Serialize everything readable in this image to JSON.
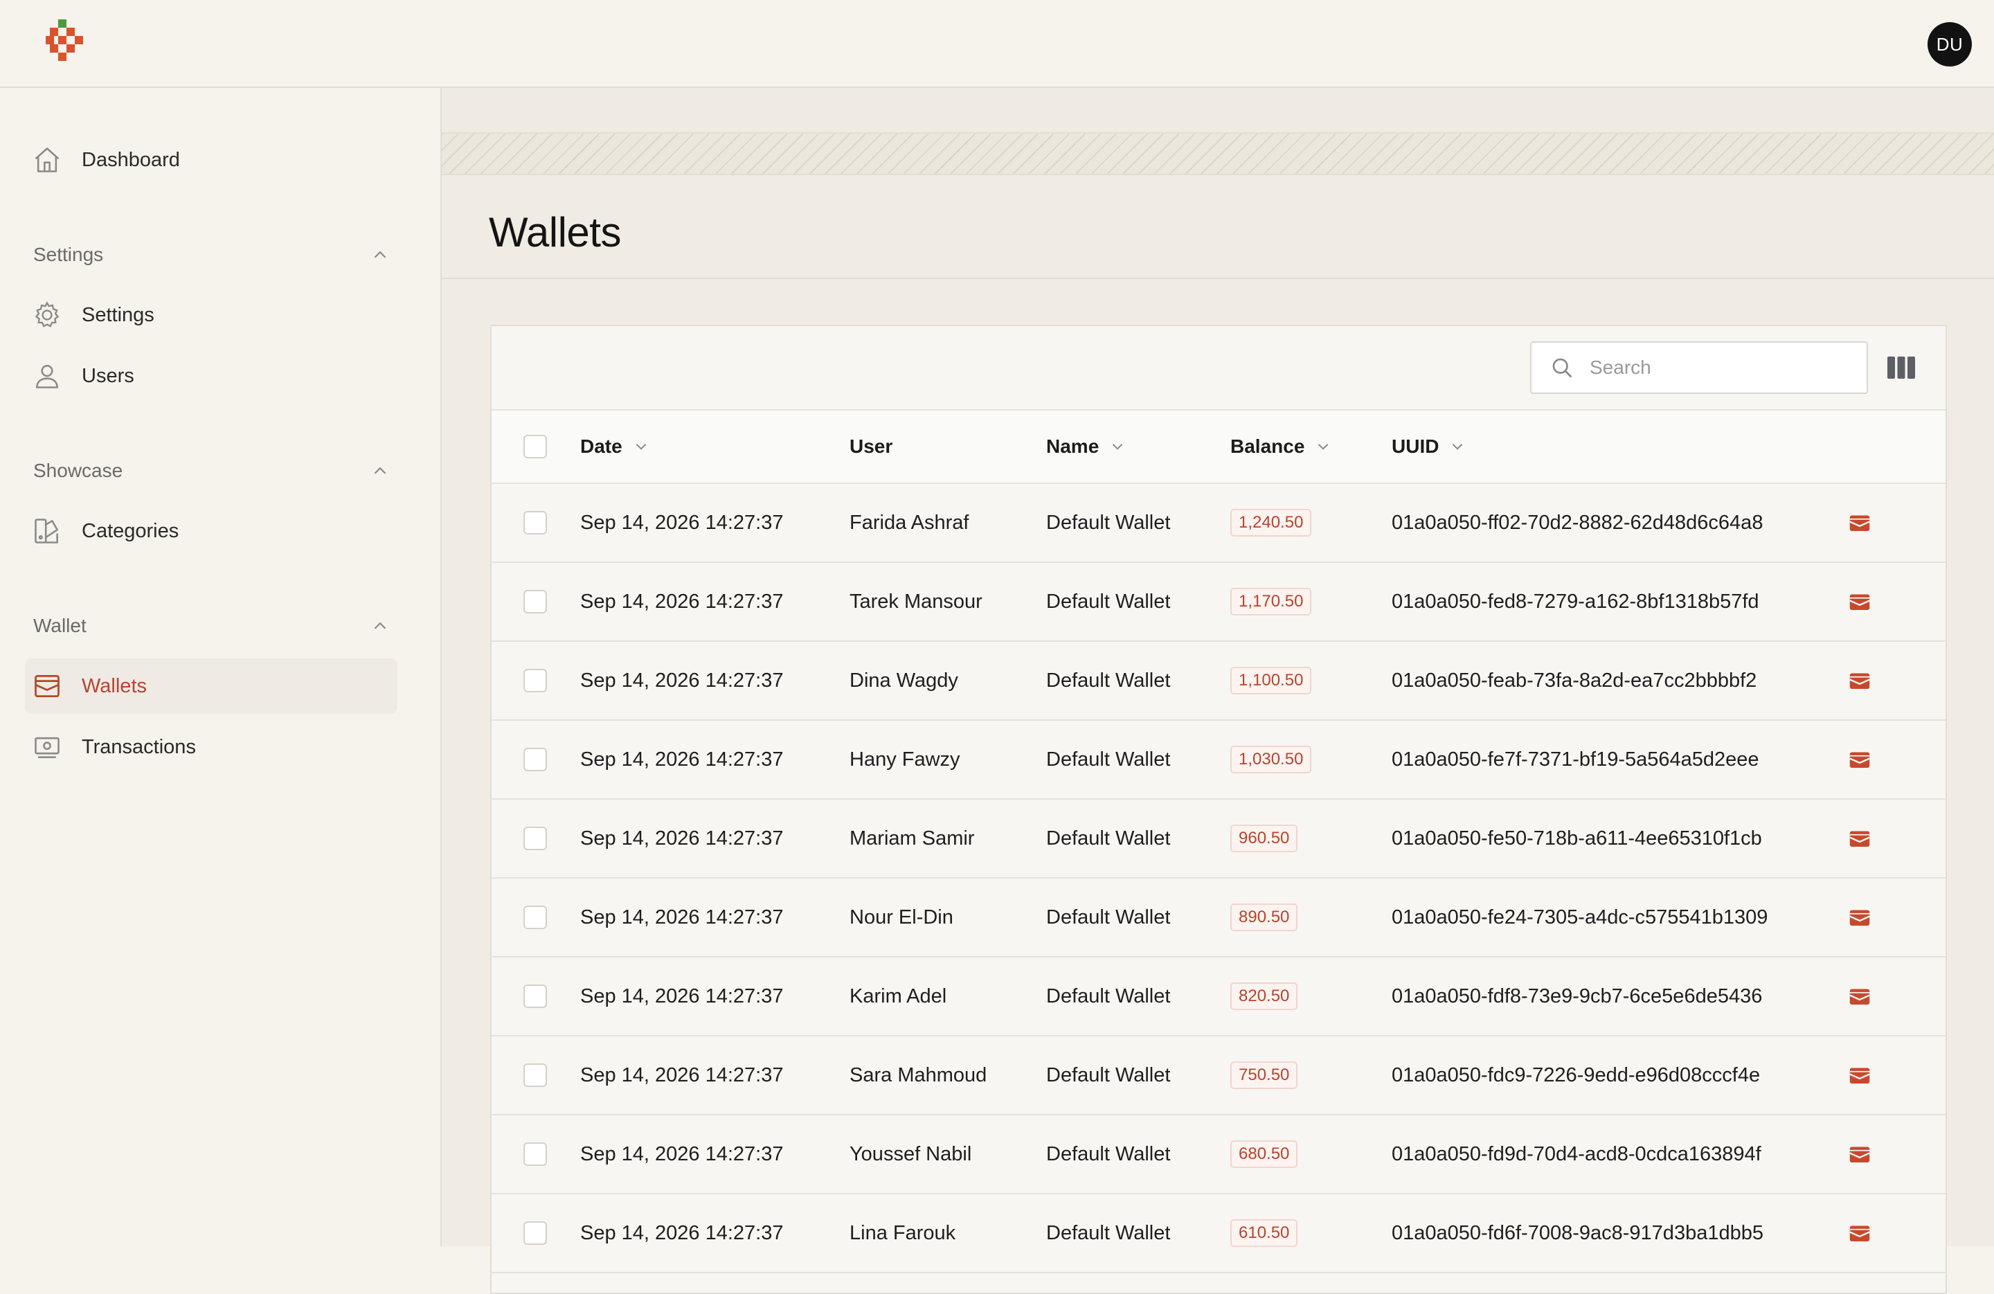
{
  "user": {
    "initials": "DU"
  },
  "sidebar": {
    "dashboard_label": "Dashboard",
    "sections": [
      {
        "title": "Settings",
        "items": [
          {
            "label": "Settings",
            "icon": "gear-icon"
          },
          {
            "label": "Users",
            "icon": "user-icon"
          }
        ]
      },
      {
        "title": "Showcase",
        "items": [
          {
            "label": "Categories",
            "icon": "categories-icon"
          }
        ]
      },
      {
        "title": "Wallet",
        "items": [
          {
            "label": "Wallets",
            "icon": "wallet-icon",
            "active": true
          },
          {
            "label": "Transactions",
            "icon": "cash-icon"
          }
        ]
      }
    ]
  },
  "page": {
    "title": "Wallets"
  },
  "search": {
    "placeholder": "Search"
  },
  "table": {
    "columns": [
      {
        "label": "Date",
        "sortable": true
      },
      {
        "label": "User",
        "sortable": false
      },
      {
        "label": "Name",
        "sortable": true
      },
      {
        "label": "Balance",
        "sortable": true
      },
      {
        "label": "UUID",
        "sortable": true
      }
    ],
    "rows": [
      {
        "date": "Sep 14, 2026 14:27:37",
        "user": "Farida Ashraf",
        "name": "Default Wallet",
        "balance": "1,240.50",
        "uuid": "01a0a050-ff02-70d2-8882-62d48d6c64a8"
      },
      {
        "date": "Sep 14, 2026 14:27:37",
        "user": "Tarek Mansour",
        "name": "Default Wallet",
        "balance": "1,170.50",
        "uuid": "01a0a050-fed8-7279-a162-8bf1318b57fd"
      },
      {
        "date": "Sep 14, 2026 14:27:37",
        "user": "Dina Wagdy",
        "name": "Default Wallet",
        "balance": "1,100.50",
        "uuid": "01a0a050-feab-73fa-8a2d-ea7cc2bbbbf2"
      },
      {
        "date": "Sep 14, 2026 14:27:37",
        "user": "Hany Fawzy",
        "name": "Default Wallet",
        "balance": "1,030.50",
        "uuid": "01a0a050-fe7f-7371-bf19-5a564a5d2eee"
      },
      {
        "date": "Sep 14, 2026 14:27:37",
        "user": "Mariam Samir",
        "name": "Default Wallet",
        "balance": "960.50",
        "uuid": "01a0a050-fe50-718b-a611-4ee65310f1cb"
      },
      {
        "date": "Sep 14, 2026 14:27:37",
        "user": "Nour El-Din",
        "name": "Default Wallet",
        "balance": "890.50",
        "uuid": "01a0a050-fe24-7305-a4dc-c575541b1309"
      },
      {
        "date": "Sep 14, 2026 14:27:37",
        "user": "Karim Adel",
        "name": "Default Wallet",
        "balance": "820.50",
        "uuid": "01a0a050-fdf8-73e9-9cb7-6ce5e6de5436"
      },
      {
        "date": "Sep 14, 2026 14:27:37",
        "user": "Sara Mahmoud",
        "name": "Default Wallet",
        "balance": "750.50",
        "uuid": "01a0a050-fdc9-7226-9edd-e96d08cccf4e"
      },
      {
        "date": "Sep 14, 2026 14:27:37",
        "user": "Youssef Nabil",
        "name": "Default Wallet",
        "balance": "680.50",
        "uuid": "01a0a050-fd9d-70d4-acd8-0cdca163894f"
      },
      {
        "date": "Sep 14, 2026 14:27:37",
        "user": "Lina Farouk",
        "name": "Default Wallet",
        "balance": "610.50",
        "uuid": "01a0a050-fd6f-7008-9ac8-917d3ba1dbb5"
      }
    ]
  },
  "colors": {
    "accent": "#b8442d",
    "background": "#f6f2ec",
    "panel": "#f0ece3",
    "avatar": "#121212"
  }
}
